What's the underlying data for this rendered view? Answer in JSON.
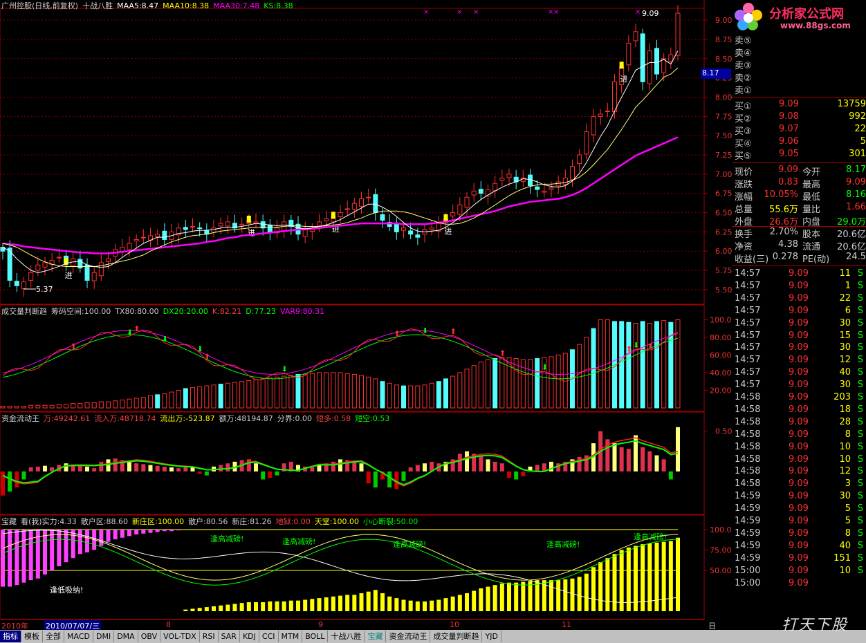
{
  "main": {
    "header": [
      {
        "text": "广州控股(日线,前复权)",
        "color": "#cccccc"
      },
      {
        "text": "十战八胜",
        "color": "#cccccc"
      },
      {
        "text": "MAA5:8.47",
        "color": "#ffffff"
      },
      {
        "text": "MAA10:8.38",
        "color": "#ffff00"
      },
      {
        "text": "MAA30:7.48",
        "color": "#ff00ff"
      },
      {
        "text": "KS:8.38",
        "color": "#00ff00"
      }
    ],
    "y_ticks": [
      "9.00",
      "8.75",
      "8.50",
      "8.25",
      "8.00",
      "7.75",
      "7.50",
      "7.25",
      "7.00",
      "6.75",
      "6.50",
      "6.25",
      "6.00",
      "5.75",
      "5.50"
    ],
    "high_label": "9.09",
    "low_label": "5.37",
    "cursor_price": "8.17",
    "jin_label": "进"
  },
  "chart_data": [
    {
      "type": "candlestick",
      "name": "",
      "ylim": [
        5.4,
        9.1
      ],
      "closes": [
        6.0,
        5.62,
        5.55,
        5.6,
        5.72,
        5.82,
        5.85,
        5.88,
        5.92,
        5.85,
        5.9,
        5.78,
        5.62,
        5.72,
        5.85,
        5.9,
        6.02,
        6.05,
        6.1,
        6.15,
        6.18,
        6.2,
        6.22,
        6.15,
        6.25,
        6.3,
        6.28,
        6.32,
        6.3,
        6.22,
        6.3,
        6.36,
        6.38,
        6.3,
        6.35,
        6.4,
        6.38,
        6.3,
        6.25,
        6.3,
        6.38,
        6.32,
        6.22,
        6.28,
        6.3,
        6.38,
        6.42,
        6.45,
        6.5,
        6.55,
        6.62,
        6.68,
        6.7,
        6.5,
        6.4,
        6.32,
        6.25,
        6.3,
        6.22,
        6.18,
        6.28,
        6.3,
        6.36,
        6.42,
        6.5,
        6.6,
        6.7,
        6.78,
        6.75,
        6.8,
        6.88,
        6.95,
        7.0,
        6.9,
        6.95,
        6.85,
        6.8,
        6.78,
        6.82,
        6.9,
        6.95,
        7.1,
        7.25,
        7.55,
        7.75,
        7.78,
        7.82,
        8.2,
        8.4,
        8.7,
        8.85,
        8.2,
        8.6,
        8.3,
        8.5,
        8.55,
        9.09
      ],
      "ma5": [
        6.05,
        6.0,
        5.9,
        5.82,
        5.75,
        5.72,
        5.74,
        5.77,
        5.8,
        5.84,
        5.86,
        5.87,
        5.82,
        5.8,
        5.79,
        5.8,
        5.85,
        5.92,
        5.98,
        6.04,
        6.1,
        6.14,
        6.18,
        6.18,
        6.2,
        6.23,
        6.24,
        6.26,
        6.27,
        6.27,
        6.28,
        6.3,
        6.31,
        6.31,
        6.32,
        6.34,
        6.36,
        6.35,
        6.34,
        6.33,
        6.34,
        6.33,
        6.3,
        6.29,
        6.3,
        6.32,
        6.34,
        6.37,
        6.41,
        6.46,
        6.51,
        6.56,
        6.61,
        6.61,
        6.57,
        6.52,
        6.45,
        6.37,
        6.3,
        6.26,
        6.25,
        6.26,
        6.27,
        6.31,
        6.37,
        6.44,
        6.52,
        6.6,
        6.67,
        6.73,
        6.78,
        6.83,
        6.87,
        6.9,
        6.94,
        6.93,
        6.9,
        6.86,
        6.84,
        6.83,
        6.85,
        6.91,
        7.01,
        7.15,
        7.32,
        7.49,
        7.63,
        7.82,
        8.0,
        8.17,
        8.35,
        8.4,
        8.45,
        8.45,
        8.49,
        8.43,
        8.6
      ],
      "ma10": [
        6.1,
        6.08,
        6.05,
        6.0,
        5.95,
        5.9,
        5.86,
        5.83,
        5.81,
        5.8,
        5.8,
        5.8,
        5.8,
        5.8,
        5.81,
        5.83,
        5.85,
        5.87,
        5.89,
        5.92,
        5.95,
        6.0,
        6.04,
        6.08,
        6.12,
        6.15,
        6.18,
        6.2,
        6.21,
        6.22,
        6.24,
        6.26,
        6.27,
        6.28,
        6.29,
        6.3,
        6.31,
        6.31,
        6.31,
        6.31,
        6.32,
        6.33,
        6.33,
        6.32,
        6.32,
        6.32,
        6.33,
        6.34,
        6.35,
        6.37,
        6.4,
        6.43,
        6.47,
        6.5,
        6.52,
        6.52,
        6.52,
        6.51,
        6.49,
        6.46,
        6.43,
        6.4,
        6.37,
        6.35,
        6.35,
        6.36,
        6.39,
        6.43,
        6.48,
        6.54,
        6.6,
        6.66,
        6.72,
        6.77,
        6.81,
        6.84,
        6.86,
        6.87,
        6.87,
        6.88,
        6.89,
        6.92,
        6.96,
        7.03,
        7.12,
        7.22,
        7.32,
        7.45,
        7.58,
        7.72,
        7.87,
        7.96,
        8.06,
        8.16,
        8.26,
        8.3,
        8.38
      ],
      "ma30": [
        6.1,
        6.09,
        6.08,
        6.06,
        6.05,
        6.04,
        6.03,
        6.02,
        6.01,
        6.0,
        5.99,
        5.98,
        5.98,
        5.97,
        5.97,
        5.97,
        5.98,
        5.99,
        6.0,
        6.01,
        6.02,
        6.03,
        6.04,
        6.05,
        6.06,
        6.07,
        6.08,
        6.09,
        6.1,
        6.12,
        6.13,
        6.15,
        6.17,
        6.18,
        6.2,
        6.21,
        6.22,
        6.23,
        6.24,
        6.25,
        6.26,
        6.27,
        6.28,
        6.28,
        6.29,
        6.3,
        6.31,
        6.32,
        6.33,
        6.34,
        6.35,
        6.36,
        6.36,
        6.36,
        6.36,
        6.36,
        6.36,
        6.35,
        6.35,
        6.35,
        6.35,
        6.36,
        6.37,
        6.38,
        6.4,
        6.42,
        6.44,
        6.46,
        6.48,
        6.5,
        6.52,
        6.55,
        6.58,
        6.6,
        6.62,
        6.64,
        6.65,
        6.66,
        6.67,
        6.68,
        6.7,
        6.73,
        6.77,
        6.82,
        6.88,
        6.94,
        7.0,
        7.06,
        7.12,
        7.18,
        7.24,
        7.28,
        7.32,
        7.36,
        7.4,
        7.44,
        7.48
      ]
    },
    {
      "type": "bar",
      "name": "成交量判断趋",
      "ylim": [
        0,
        105
      ],
      "values": [
        2,
        2,
        2,
        2,
        3,
        3,
        3,
        3,
        4,
        4,
        5,
        5,
        6,
        6,
        7,
        7,
        8,
        9,
        10,
        11,
        12,
        14,
        15,
        16,
        18,
        20,
        22,
        23,
        24,
        25,
        26,
        27,
        28,
        29,
        30,
        31,
        32,
        33,
        34,
        35,
        36,
        37,
        38,
        38,
        39,
        40,
        40,
        40,
        40,
        39,
        38,
        37,
        35,
        33,
        30,
        28,
        26,
        25,
        25,
        25,
        26,
        28,
        30,
        33,
        36,
        40,
        44,
        48,
        52,
        55,
        56,
        57,
        57,
        56,
        55,
        55,
        56,
        57,
        58,
        60,
        62,
        66,
        72,
        80,
        90,
        100,
        100,
        98,
        98,
        97,
        96,
        98,
        96,
        98,
        99,
        97,
        100
      ],
      "cyan_idx": [
        22,
        26,
        31,
        42,
        54,
        57,
        62,
        63,
        70,
        76,
        81,
        84,
        87,
        88,
        89,
        91,
        93,
        95
      ],
      "ticks": [
        "100.0",
        "80.00",
        "60.00",
        "40.00",
        "20.00"
      ]
    },
    {
      "type": "bar",
      "name": "资金流动王",
      "ylim": [
        -0.5,
        0.6
      ],
      "values": [
        -0.3,
        -0.25,
        -0.2,
        -0.1,
        0.05,
        0.06,
        0.07,
        0.05,
        0.08,
        0.1,
        0.08,
        0.07,
        0.06,
        0.04,
        0.12,
        0.15,
        0.16,
        0.14,
        0.12,
        0.1,
        0.09,
        0.08,
        0.07,
        0.06,
        0.05,
        0.04,
        0.06,
        0.05,
        -0.03,
        -0.05,
        0.06,
        0.08,
        0.1,
        0.12,
        0.14,
        0.15,
        0.1,
        -0.1,
        -0.08,
        -0.05,
        0.1,
        0.12,
        0.08,
        0.06,
        0.05,
        0.08,
        0.1,
        0.12,
        0.15,
        0.14,
        0.12,
        0.1,
        -0.15,
        -0.2,
        -0.1,
        -0.2,
        -0.22,
        -0.12,
        0.05,
        0.08,
        0.1,
        0.12,
        0.1,
        0.12,
        0.15,
        0.22,
        0.25,
        0.22,
        0.2,
        0.15,
        0.12,
        0.1,
        -0.08,
        -0.1,
        -0.06,
        0.06,
        0.08,
        0.1,
        0.12,
        0.1,
        0.12,
        0.15,
        0.18,
        0.2,
        0.35,
        0.5,
        0.4,
        0.35,
        0.3,
        0.28,
        0.45,
        0.3,
        0.25,
        0.2,
        0.15,
        -0.1,
        0.55
      ],
      "ticks": [
        "0.50"
      ]
    },
    {
      "type": "bar",
      "name": "宝藏",
      "ylim": [
        0,
        105
      ],
      "values": [
        -70,
        -70,
        -68,
        -65,
        -62,
        -60,
        -55,
        -50,
        -45,
        -40,
        -35,
        -30,
        -28,
        -25,
        -20,
        -15,
        -12,
        -10,
        -8,
        -6,
        -5,
        -4,
        -3,
        -2,
        -2,
        -1,
        2,
        3,
        4,
        5,
        6,
        7,
        8,
        9,
        10,
        11,
        11,
        11,
        12,
        12,
        12,
        13,
        13,
        14,
        15,
        16,
        17,
        18,
        19,
        20,
        20,
        22,
        24,
        26,
        22,
        18,
        16,
        14,
        13,
        12,
        12,
        13,
        14,
        16,
        18,
        20,
        22,
        25,
        28,
        30,
        32,
        34,
        35,
        35,
        36,
        37,
        38,
        38,
        38,
        38,
        39,
        40,
        42,
        46,
        54,
        60,
        65,
        70,
        75,
        78,
        80,
        82,
        83,
        84,
        85,
        86,
        90
      ],
      "ticks": [
        "100.0",
        "75.00",
        "50.00"
      ]
    }
  ],
  "vol_panel": {
    "header": [
      {
        "text": "成交量判断趋",
        "color": "#cccccc"
      },
      {
        "text": "筹码空间:100.00",
        "color": "#cccccc"
      },
      {
        "text": "TX80:80.00",
        "color": "#cccccc"
      },
      {
        "text": "DX20:20.00",
        "color": "#00ff00"
      },
      {
        "text": "K:82.21",
        "color": "#ff4040"
      },
      {
        "text": "D:77.23",
        "color": "#00ff00"
      },
      {
        "text": "VAR9:80.31",
        "color": "#ff00ff"
      }
    ]
  },
  "flow_panel": {
    "header": [
      {
        "text": "资金流动王",
        "color": "#cccccc"
      },
      {
        "text": "万:49242.61",
        "color": "#ff4040"
      },
      {
        "text": "流入万:48718.74",
        "color": "#ff4040"
      },
      {
        "text": "流出万:-523.87",
        "color": "#ffff00"
      },
      {
        "text": "额万:48194.87",
        "color": "#cccccc"
      },
      {
        "text": "分界:0.00",
        "color": "#cccccc"
      },
      {
        "text": "短多:0.58",
        "color": "#ff4040"
      },
      {
        "text": "短空:0.53",
        "color": "#00ff00"
      }
    ]
  },
  "treasure_panel": {
    "header": [
      {
        "text": "宝藏",
        "color": "#cccccc"
      },
      {
        "text": "看(我)实力:4.33",
        "color": "#cccccc"
      },
      {
        "text": "散户区:88.60",
        "color": "#cccccc"
      },
      {
        "text": "新庄区:100.00",
        "color": "#ffff00"
      },
      {
        "text": "散户:80.56",
        "color": "#cccccc"
      },
      {
        "text": "新庄:81.26",
        "color": "#cccccc"
      },
      {
        "text": "地狱:0.00",
        "color": "#ff4040"
      },
      {
        "text": "天堂:100.00",
        "color": "#ffff00"
      },
      {
        "text": "小心断裂:50.00",
        "color": "#00ff00"
      }
    ],
    "annotations": [
      "逢高减磅!",
      "逢高减磅!",
      "逢高减磅!",
      "逢高减磅!",
      "逢高减磅!",
      "逢低吸纳!"
    ]
  },
  "date_bar": {
    "year": "2010年",
    "date": "2010/07/07/三",
    "months": [
      "8",
      "9",
      "10",
      "11"
    ],
    "period": "日线"
  },
  "right": {
    "logo_text": "分析家公式网",
    "logo_url": "www.88gs.com",
    "sell": [
      {
        "label": "卖⑤",
        "price": "",
        "vol": ""
      },
      {
        "label": "卖④",
        "price": "",
        "vol": ""
      },
      {
        "label": "卖③",
        "price": "",
        "vol": ""
      },
      {
        "label": "卖②",
        "price": "",
        "vol": ""
      },
      {
        "label": "卖①",
        "price": "",
        "vol": ""
      }
    ],
    "buy": [
      {
        "label": "买①",
        "price": "9.09",
        "vol": "13759"
      },
      {
        "label": "买②",
        "price": "9.08",
        "vol": "992"
      },
      {
        "label": "买③",
        "price": "9.07",
        "vol": "22"
      },
      {
        "label": "买④",
        "price": "9.06",
        "vol": "5"
      },
      {
        "label": "买⑤",
        "price": "9.05",
        "vol": "301"
      }
    ],
    "quote": [
      {
        "l1": "现价",
        "v1": "9.09",
        "c1": "#ff3030",
        "l2": "今开",
        "v2": "8.17",
        "c2": "#00ff00"
      },
      {
        "l1": "涨跌",
        "v1": "0.83",
        "c1": "#ff3030",
        "l2": "最高",
        "v2": "9.09",
        "c2": "#ff3030"
      },
      {
        "l1": "涨幅",
        "v1": "10.05%",
        "c1": "#ff3030",
        "l2": "最低",
        "v2": "8.16",
        "c2": "#00ff00"
      },
      {
        "l1": "总量",
        "v1": "55.6万",
        "c1": "#ffff00",
        "l2": "量比",
        "v2": "1.66",
        "c2": "#ff3030"
      },
      {
        "l1": "外盘",
        "v1": "26.6万",
        "c1": "#ff3030",
        "l2": "内盘",
        "v2": "29.0万",
        "c2": "#00ff00"
      },
      {
        "l1": "换手",
        "v1": "2.70%",
        "c1": "#cccccc",
        "l2": "股本",
        "v2": "20.6亿",
        "c2": "#cccccc"
      },
      {
        "l1": "净资",
        "v1": "4.38",
        "c1": "#cccccc",
        "l2": "流通",
        "v2": "20.6亿",
        "c2": "#cccccc"
      },
      {
        "l1": "收益(三)",
        "v1": "0.278",
        "c1": "#cccccc",
        "l2": "PE(动)",
        "v2": "24.5",
        "c2": "#cccccc"
      }
    ],
    "ticks": [
      {
        "t": "14:57",
        "p": "9.09",
        "v": "11",
        "s": "S"
      },
      {
        "t": "14:57",
        "p": "9.09",
        "v": "1",
        "s": "S"
      },
      {
        "t": "14:57",
        "p": "9.09",
        "v": "22",
        "s": "S"
      },
      {
        "t": "14:57",
        "p": "9.09",
        "v": "6",
        "s": "S"
      },
      {
        "t": "14:57",
        "p": "9.09",
        "v": "30",
        "s": "S"
      },
      {
        "t": "14:57",
        "p": "9.09",
        "v": "15",
        "s": "S"
      },
      {
        "t": "14:57",
        "p": "9.09",
        "v": "30",
        "s": "S"
      },
      {
        "t": "14:57",
        "p": "9.09",
        "v": "12",
        "s": "S"
      },
      {
        "t": "14:57",
        "p": "9.09",
        "v": "40",
        "s": "S"
      },
      {
        "t": "14:57",
        "p": "9.09",
        "v": "30",
        "s": "S"
      },
      {
        "t": "14:58",
        "p": "9.09",
        "v": "203",
        "s": "S"
      },
      {
        "t": "14:58",
        "p": "9.09",
        "v": "18",
        "s": "S"
      },
      {
        "t": "14:58",
        "p": "9.09",
        "v": "28",
        "s": "S"
      },
      {
        "t": "14:58",
        "p": "9.09",
        "v": "8",
        "s": "S"
      },
      {
        "t": "14:58",
        "p": "9.09",
        "v": "10",
        "s": "S"
      },
      {
        "t": "14:58",
        "p": "9.09",
        "v": "10",
        "s": "S"
      },
      {
        "t": "14:58",
        "p": "9.09",
        "v": "12",
        "s": "S"
      },
      {
        "t": "14:58",
        "p": "9.09",
        "v": "3",
        "s": "S"
      },
      {
        "t": "14:59",
        "p": "9.09",
        "v": "30",
        "s": "S"
      },
      {
        "t": "14:59",
        "p": "9.09",
        "v": "5",
        "s": "S"
      },
      {
        "t": "14:59",
        "p": "9.09",
        "v": "5",
        "s": "S"
      },
      {
        "t": "14:59",
        "p": "9.09",
        "v": "8",
        "s": "S"
      },
      {
        "t": "14:59",
        "p": "9.09",
        "v": "40",
        "s": "S"
      },
      {
        "t": "14:59",
        "p": "9.09",
        "v": "151",
        "s": "S"
      },
      {
        "t": "15:00",
        "p": "9.09",
        "v": "10",
        "s": "S"
      },
      {
        "t": "15:00",
        "p": "9.09",
        "v": "",
        "s": ""
      }
    ]
  },
  "tabs": [
    "指标",
    "模板",
    "全部",
    "MACD",
    "DMI",
    "DMA",
    "OBV",
    "VOL-TDX",
    "RSI",
    "SAR",
    "KDJ",
    "CCI",
    "MTM",
    "BOLL",
    "十战八胜",
    "宝藏",
    "资金流动王",
    "成交量判断趋",
    "YJD"
  ],
  "active_tab": "指标",
  "watermark": "打天下股"
}
